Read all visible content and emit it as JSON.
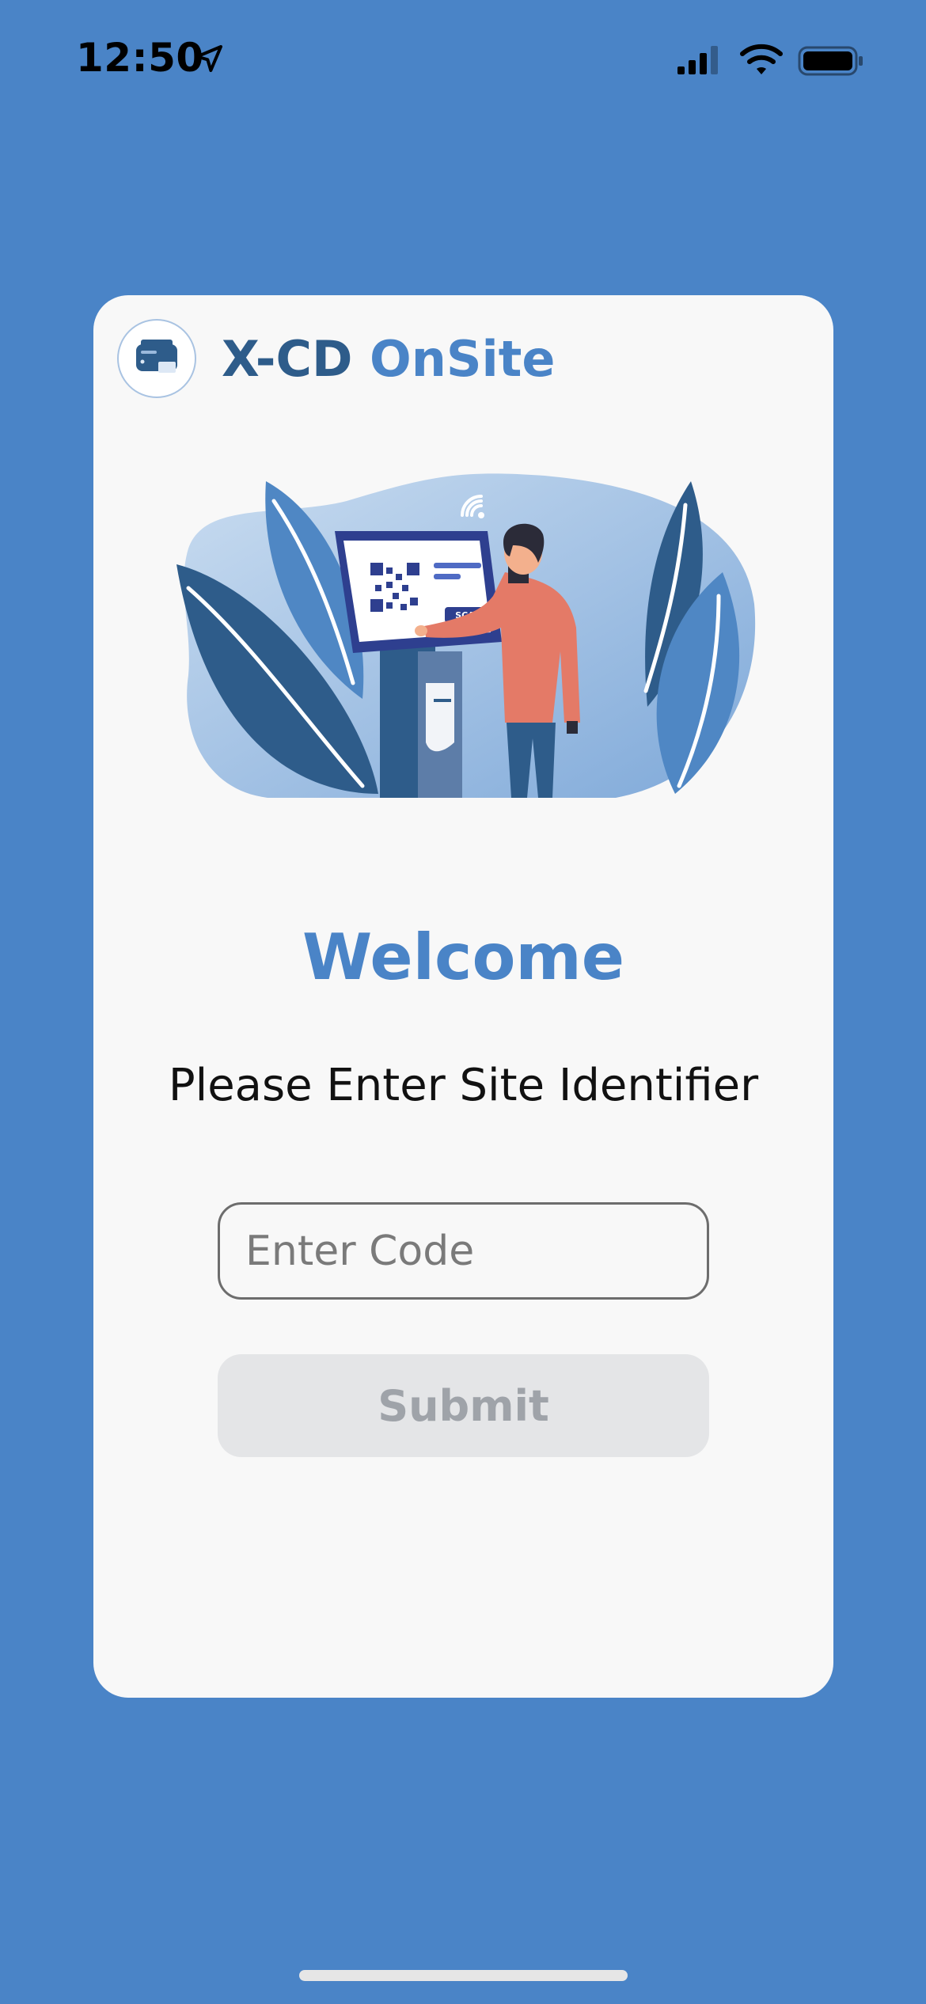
{
  "status_bar": {
    "time": "12:50",
    "icons": [
      "location-arrow-icon",
      "cellular-signal-icon",
      "wifi-icon",
      "battery-icon"
    ]
  },
  "brand": {
    "logo_icon": "printer-icon",
    "name_part1": "X-CD",
    "name_part2": "OnSite"
  },
  "illustration": {
    "icon": "kiosk-qr-scan-illustration",
    "scan_label": "SCAN"
  },
  "welcome": {
    "title": "Welcome",
    "subtitle": "Please Enter Site Identifier"
  },
  "form": {
    "code_value": "",
    "code_placeholder": "Enter Code",
    "submit_label": "Submit"
  },
  "colors": {
    "background": "#4A84C7",
    "card": "#F8F8F8",
    "brand_dark": "#2E5C8A",
    "accent": "#4A84C7",
    "button_disabled_bg": "#E4E5E7",
    "button_disabled_text": "#9FA3A9"
  }
}
